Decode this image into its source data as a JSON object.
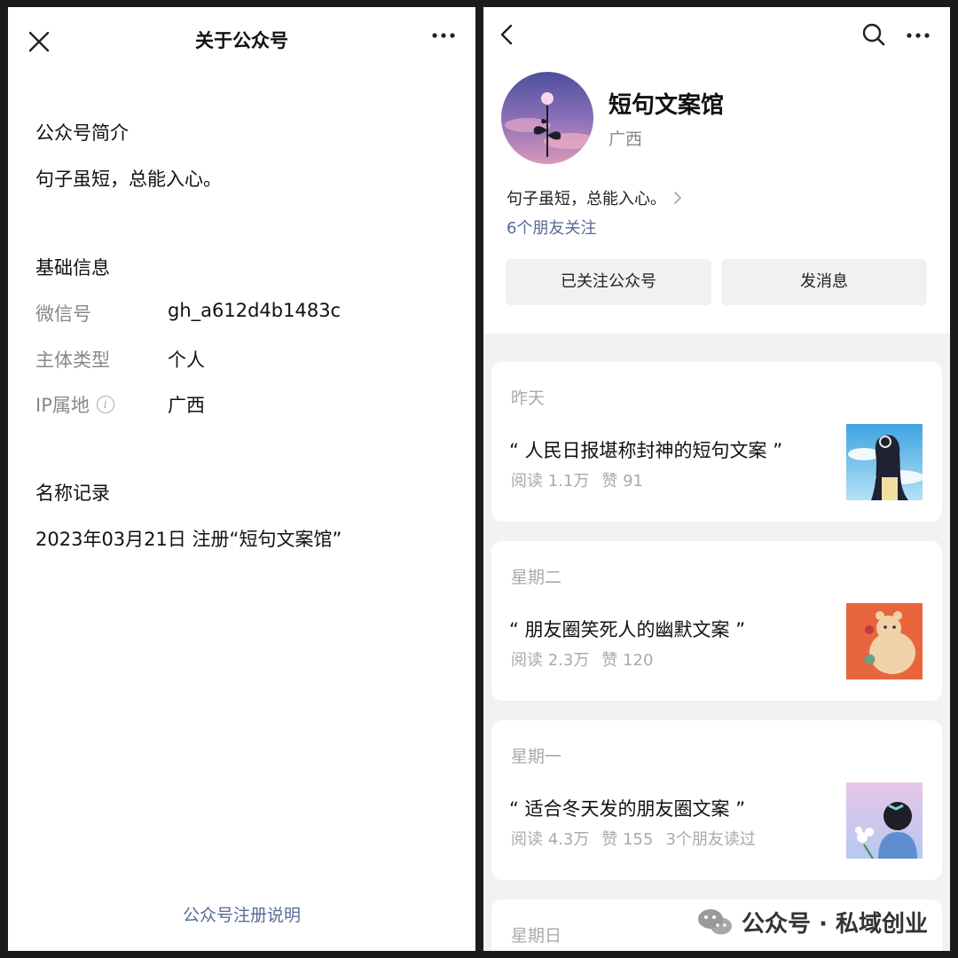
{
  "left_panel": {
    "header": {
      "title": "关于公众号",
      "close_icon": "close-icon",
      "more_icon": "more-icon"
    },
    "intro": {
      "heading": "公众号简介",
      "text": "句子虽短，总能入心。"
    },
    "basic_info": {
      "heading": "基础信息",
      "rows": [
        {
          "label": "微信号",
          "value": "gh_a612d4b1483c"
        },
        {
          "label": "主体类型",
          "value": "个人"
        },
        {
          "label": "IP属地",
          "value": "广西",
          "info_icon": "info-icon"
        }
      ]
    },
    "name_history": {
      "heading": "名称记录",
      "entries": [
        "2023年03月21日 注册“短句文案馆”"
      ]
    },
    "footer_link": "公众号注册说明"
  },
  "right_panel": {
    "header": {
      "back_icon": "back-icon",
      "search_icon": "search-icon",
      "more_icon": "more-icon"
    },
    "account": {
      "name": "短句文案馆",
      "location": "广西",
      "description": "句子虽短，总能入心。",
      "friends_following": "6个朋友关注"
    },
    "buttons": {
      "follow": "已关注公众号",
      "message": "发消息"
    },
    "articles": [
      {
        "day": "昨天",
        "title": "“ 人民日报堪称封神的短句文案 ”",
        "reads": "阅读 1.1万",
        "likes": "赞 91",
        "friends_read": ""
      },
      {
        "day": "星期二",
        "title": "“ 朋友圈笑死人的幽默文案 ”",
        "reads": "阅读 2.3万",
        "likes": "赞 120",
        "friends_read": ""
      },
      {
        "day": "星期一",
        "title": "“ 适合冬天发的朋友圈文案 ”",
        "reads": "阅读 4.3万",
        "likes": "赞 155",
        "friends_read": "3个朋友读过"
      },
      {
        "day": "星期日"
      }
    ]
  },
  "watermark": {
    "text": "公众号 · 私域创业",
    "icon": "wechat-icon"
  },
  "colors": {
    "link": "#576b95",
    "muted": "#888888",
    "background": "#f2f2f2"
  }
}
